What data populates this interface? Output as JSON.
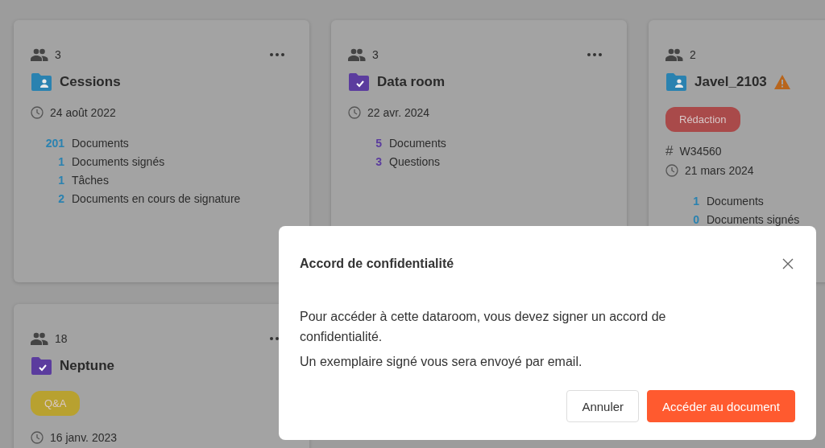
{
  "cards": [
    {
      "kind": "shared",
      "members": "3",
      "title": "Cessions",
      "warning": false,
      "date": "24 août 2022",
      "stats": [
        {
          "count": "201",
          "label": "Documents"
        },
        {
          "count": "1",
          "label": "Documents signés"
        },
        {
          "count": "1",
          "label": "Tâches"
        },
        {
          "count": "2",
          "label": "Documents en cours de signature"
        }
      ]
    },
    {
      "kind": "dataroom",
      "members": "3",
      "title": "Data room",
      "warning": false,
      "date": "22 avr. 2024",
      "stats": [
        {
          "count": "5",
          "label": "Documents"
        },
        {
          "count": "3",
          "label": "Questions"
        }
      ]
    },
    {
      "kind": "shared",
      "members": "2",
      "title": "Javel_2103",
      "warning": true,
      "badge": {
        "label": "Rédaction",
        "color": "#a94a4a"
      },
      "reference_symbol": "#",
      "reference": "W34560",
      "date": "21 mars 2024",
      "stats": [
        {
          "count": "1",
          "label": "Documents"
        },
        {
          "count": "0",
          "label": "Documents signés"
        }
      ]
    },
    {
      "kind": "dataroom",
      "members": "18",
      "title": "Neptune",
      "warning": false,
      "badge": {
        "label": "Q&A",
        "color": "#b8a130"
      },
      "date": "16 janv. 2023"
    }
  ],
  "dialog": {
    "title": "Accord de confidentialité",
    "paragraphs": [
      "Pour accéder à cette dataroom, vous devez signer un accord de confidentialité.",
      "Un exemplaire signé vous sera envoyé par email."
    ],
    "buttons": [
      {
        "label": "Annuler",
        "kind": "secondary"
      },
      {
        "label": "Accéder au document",
        "kind": "primary"
      }
    ]
  }
}
